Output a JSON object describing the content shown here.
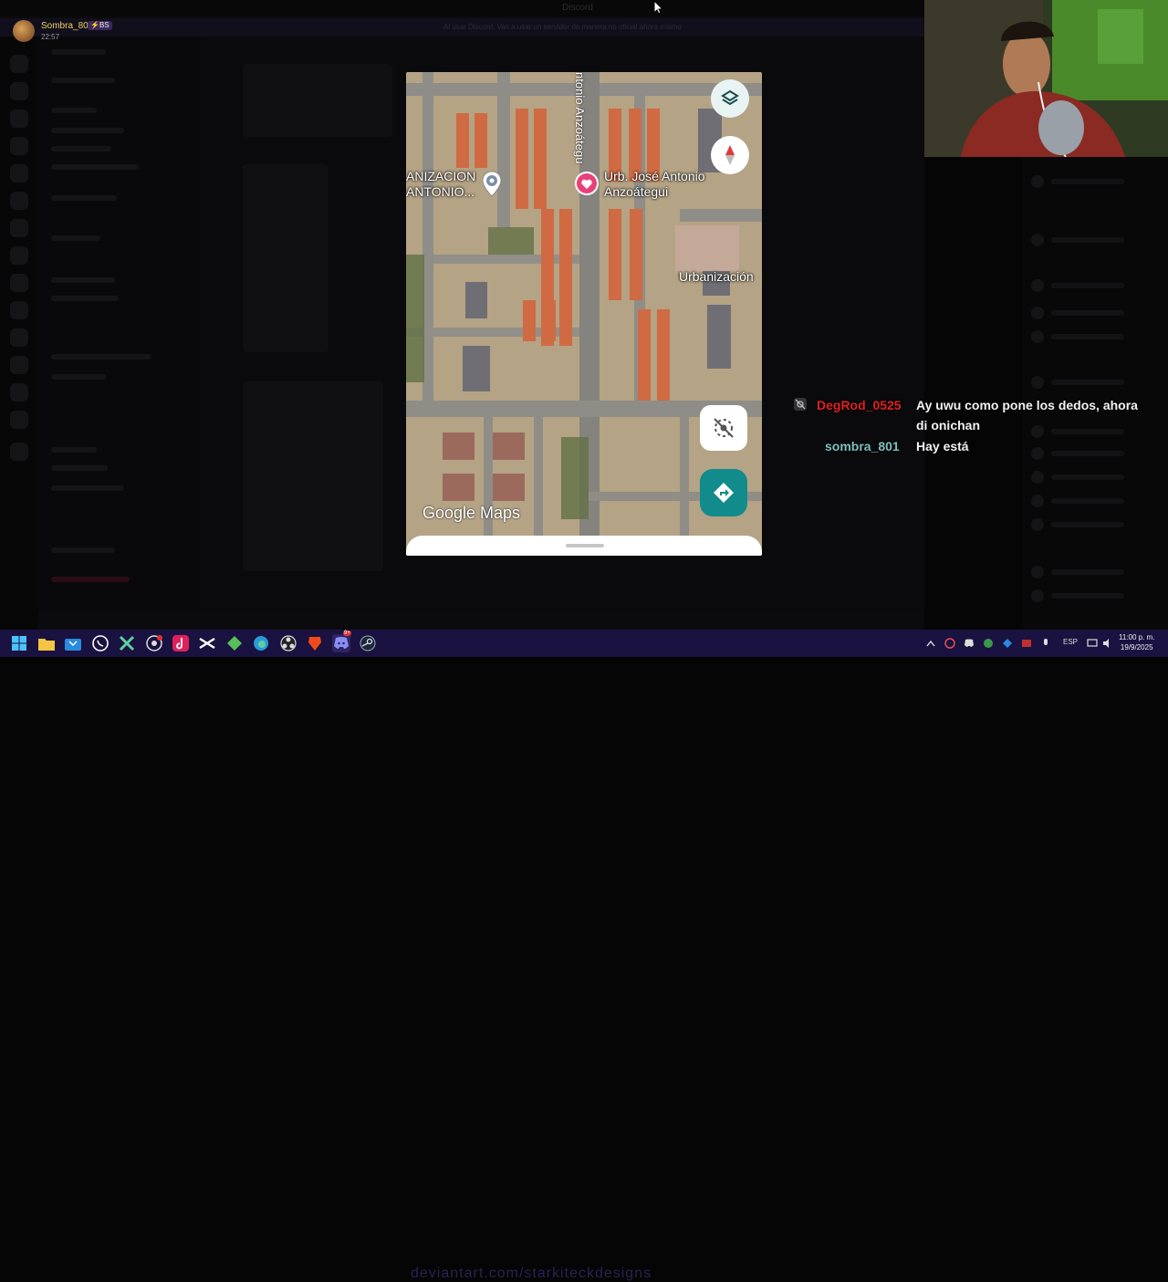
{
  "background": {
    "window_title": "Discord",
    "notice_text": "Al usar Discord, Vas a usar un servidor de manera no oficial ahora mismo"
  },
  "overlay_user": {
    "name": "Sombra_80",
    "badge": "⚡BS",
    "time": "22:57"
  },
  "map": {
    "street_vertical": "ntonio Anzoátegu",
    "label_left": "ANIZACION\nANTONIO...",
    "label_pin": "Urb. José Antonio\nAnzoátegui",
    "label_right": "Urbanización",
    "watermark": "Google Maps",
    "icons": [
      "layers-icon",
      "compass-icon",
      "location-off-icon",
      "directions-icon",
      "place-pin-icon",
      "heart-pin-icon"
    ]
  },
  "chat": {
    "messages": [
      {
        "user": "DegRod_0525",
        "text": "Ay uwu como pone los dedos, ahora di onichan",
        "color": "#e02020"
      },
      {
        "user": "sombra_801",
        "text": "Hay está",
        "color": "#7fbfbf"
      }
    ]
  },
  "taskbar": {
    "watermark": "deviantart.com/starkiteckdesigns",
    "language": "ESP",
    "time": "11:00 p. m.",
    "date": "19/9/2025",
    "discord_badge": "9+",
    "apps": [
      "windows-start-icon",
      "file-explorer-icon",
      "store-icon",
      "whatsapp-icon",
      "xbox-icon",
      "chrome-icon",
      "tiktok-icon",
      "capcut-icon",
      "gem-icon",
      "edge-icon",
      "obs-icon",
      "brave-icon",
      "discord-icon",
      "steam-icon"
    ]
  },
  "colors": {
    "taskbar": "#1a1240",
    "map_accent": "#118b8b",
    "heart_pin": "#e8407a"
  }
}
